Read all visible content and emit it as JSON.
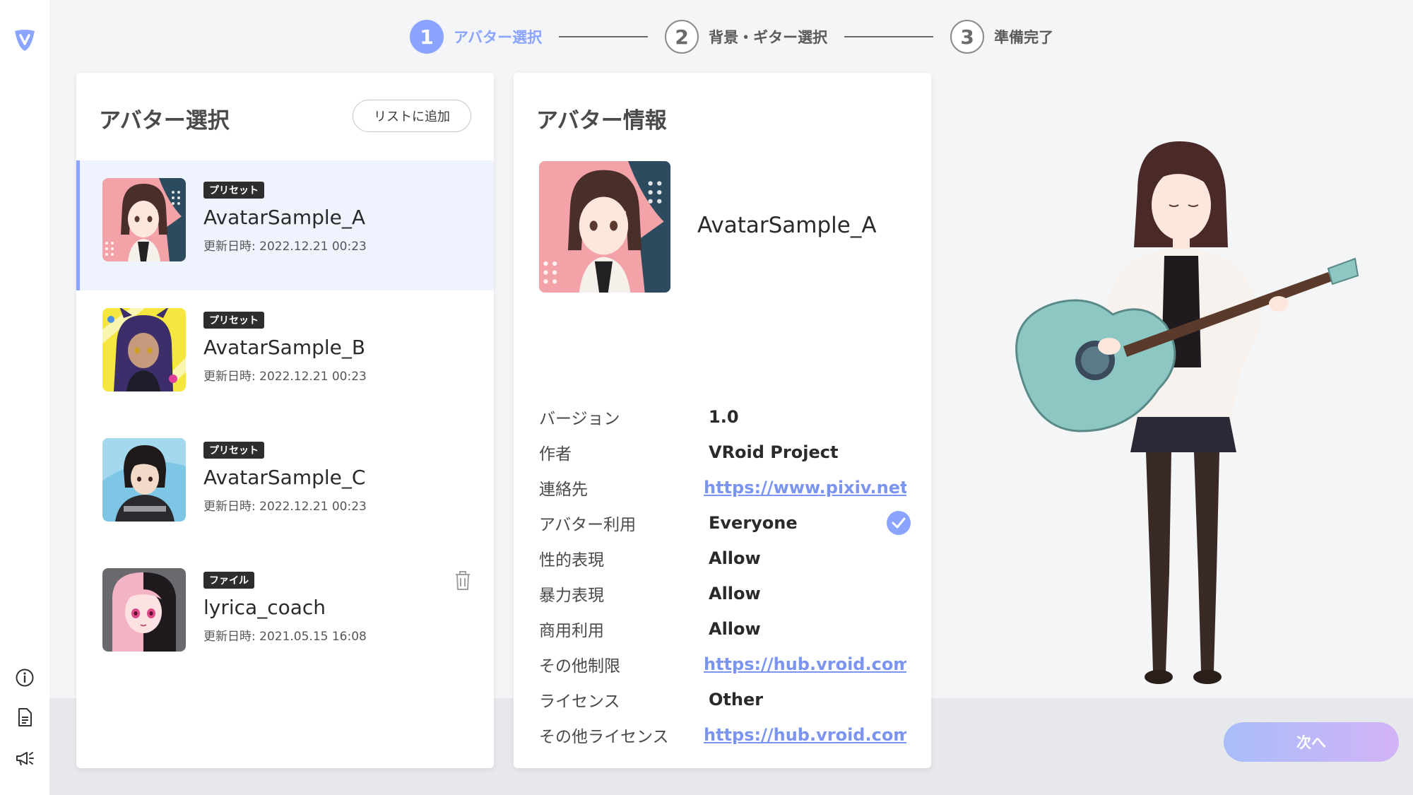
{
  "stepper": {
    "steps": [
      {
        "number": "1",
        "label": "アバター選択",
        "state": "active"
      },
      {
        "number": "2",
        "label": "背景・ギター選択",
        "state": "inactive"
      },
      {
        "number": "3",
        "label": "準備完了",
        "state": "inactive"
      }
    ]
  },
  "rail": {
    "logo_icon": "vroid-logo-icon",
    "bottom_icons": [
      "info-icon",
      "document-icon",
      "megaphone-icon"
    ]
  },
  "avatar_select": {
    "title": "アバター選択",
    "add_button_label": "リストに追加",
    "items": [
      {
        "badge": "プリセット",
        "name": "AvatarSample_A",
        "date": "更新日時: 2022.12.21 00:23",
        "selected": true
      },
      {
        "badge": "プリセット",
        "name": "AvatarSample_B",
        "date": "更新日時: 2022.12.21 00:23",
        "selected": false
      },
      {
        "badge": "プリセット",
        "name": "AvatarSample_C",
        "date": "更新日時: 2022.12.21 00:23",
        "selected": false
      },
      {
        "badge": "ファイル",
        "name": "lyrica_coach",
        "date": "更新日時: 2021.05.15 16:08",
        "selected": false,
        "deletable": true
      }
    ]
  },
  "avatar_info": {
    "title": "アバター情報",
    "name": "AvatarSample_A",
    "rows": [
      {
        "label": "バージョン",
        "value": "1.0",
        "link": false
      },
      {
        "label": "作者",
        "value": "VRoid Project",
        "link": false
      },
      {
        "label": "連絡先",
        "value": "https://www.pixiv.net/i",
        "link": true
      },
      {
        "label": "アバター利用",
        "value": "Everyone",
        "link": false,
        "checked": true
      },
      {
        "label": "性的表現",
        "value": "Allow",
        "link": false
      },
      {
        "label": "暴力表現",
        "value": "Allow",
        "link": false
      },
      {
        "label": "商用利用",
        "value": "Allow",
        "link": false
      },
      {
        "label": "その他制限",
        "value": "https://hub.vroid.com/l",
        "link": true
      },
      {
        "label": "ライセンス",
        "value": "Other",
        "link": false
      },
      {
        "label": "その他ライセンス",
        "value": "https://hub.vroid.com/l",
        "link": true
      }
    ]
  },
  "next_button_label": "次へ",
  "colors": {
    "accent": "#8aa4ff",
    "link": "#7a94f0",
    "selected_bg": "#eef3fd",
    "next_gradient_start": "#a9bdfa",
    "next_gradient_end": "#d2b3f6"
  }
}
